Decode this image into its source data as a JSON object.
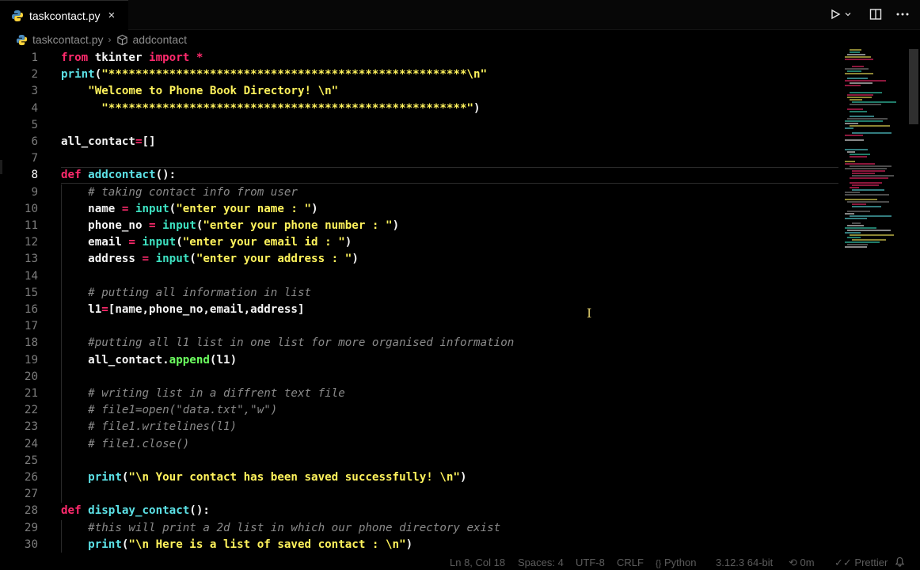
{
  "tab": {
    "filename": "taskcontact.py",
    "close_icon": "×"
  },
  "breadcrumb": {
    "file": "taskcontact.py",
    "symbol": "addcontact"
  },
  "toolbar": {
    "run_icon": "▷",
    "dropdown_icon": "⌄",
    "split_icon": "split-editor",
    "more_icon": "⋯"
  },
  "editor": {
    "current_line": 8,
    "lines": [
      {
        "n": "1",
        "tokens": [
          [
            "kw",
            "from"
          ],
          [
            "id",
            " tkinter "
          ],
          [
            "kw",
            "import"
          ],
          [
            "op",
            " *"
          ]
        ]
      },
      {
        "n": "2",
        "tokens": [
          [
            "fn",
            "print"
          ],
          [
            "pn",
            "("
          ],
          [
            "str",
            "\"*****************************************************\\n\""
          ]
        ]
      },
      {
        "n": "3",
        "tokens": [
          [
            "str",
            "    \"Welcome to Phone Book Directory! \\n\""
          ]
        ]
      },
      {
        "n": "4",
        "tokens": [
          [
            "str",
            "      \"*****************************************************\""
          ],
          [
            "pn",
            ")"
          ]
        ]
      },
      {
        "n": "5",
        "tokens": []
      },
      {
        "n": "6",
        "tokens": [
          [
            "id",
            "all_contact"
          ],
          [
            "op",
            "="
          ],
          [
            "pn",
            "[]"
          ]
        ]
      },
      {
        "n": "7",
        "tokens": []
      },
      {
        "n": "8",
        "tokens": [
          [
            "kw",
            "def"
          ],
          [
            "fn",
            " addcontact"
          ],
          [
            "pn",
            "():"
          ]
        ]
      },
      {
        "n": "9",
        "tokens": [
          [
            "cm",
            "    # taking contact info from user"
          ]
        ]
      },
      {
        "n": "10",
        "tokens": [
          [
            "id",
            "    name "
          ],
          [
            "op",
            "="
          ],
          [
            "bi",
            " input"
          ],
          [
            "pn",
            "("
          ],
          [
            "str",
            "\"enter your name : \""
          ],
          [
            "pn",
            ")"
          ]
        ]
      },
      {
        "n": "11",
        "tokens": [
          [
            "id",
            "    phone_no "
          ],
          [
            "op",
            "="
          ],
          [
            "bi",
            " input"
          ],
          [
            "pn",
            "("
          ],
          [
            "str",
            "\"enter your phone number : \""
          ],
          [
            "pn",
            ")"
          ]
        ]
      },
      {
        "n": "12",
        "tokens": [
          [
            "id",
            "    email "
          ],
          [
            "op",
            "="
          ],
          [
            "bi",
            " input"
          ],
          [
            "pn",
            "("
          ],
          [
            "str",
            "\"enter your email id : \""
          ],
          [
            "pn",
            ")"
          ]
        ]
      },
      {
        "n": "13",
        "tokens": [
          [
            "id",
            "    address "
          ],
          [
            "op",
            "="
          ],
          [
            "bi",
            " input"
          ],
          [
            "pn",
            "("
          ],
          [
            "str",
            "\"enter your address : \""
          ],
          [
            "pn",
            ")"
          ]
        ]
      },
      {
        "n": "14",
        "tokens": []
      },
      {
        "n": "15",
        "tokens": [
          [
            "cm",
            "    # putting all information in list"
          ]
        ]
      },
      {
        "n": "16",
        "tokens": [
          [
            "id",
            "    l1"
          ],
          [
            "op",
            "="
          ],
          [
            "pn",
            "["
          ],
          [
            "id",
            "name,phone_no,email,address"
          ],
          [
            "pn",
            "]"
          ]
        ]
      },
      {
        "n": "17",
        "tokens": []
      },
      {
        "n": "18",
        "tokens": [
          [
            "cm",
            "    #putting all l1 list in one list for more organised information"
          ]
        ]
      },
      {
        "n": "19",
        "tokens": [
          [
            "id",
            "    all_contact."
          ],
          [
            "meth",
            "append"
          ],
          [
            "pn",
            "("
          ],
          [
            "id",
            "l1"
          ],
          [
            "pn",
            ")"
          ]
        ]
      },
      {
        "n": "20",
        "tokens": []
      },
      {
        "n": "21",
        "tokens": [
          [
            "cm",
            "    # writing list in a diffrent text file"
          ]
        ]
      },
      {
        "n": "22",
        "tokens": [
          [
            "cm",
            "    # file1=open(\"data.txt\",\"w\")"
          ]
        ]
      },
      {
        "n": "23",
        "tokens": [
          [
            "cm",
            "    # file1.writelines(l1)"
          ]
        ]
      },
      {
        "n": "24",
        "tokens": [
          [
            "cm",
            "    # file1.close()"
          ]
        ]
      },
      {
        "n": "25",
        "tokens": []
      },
      {
        "n": "26",
        "tokens": [
          [
            "fn",
            "    print"
          ],
          [
            "pn",
            "("
          ],
          [
            "str",
            "\"\\n Your contact has been saved successfully! \\n\""
          ],
          [
            "pn",
            ")"
          ]
        ]
      },
      {
        "n": "27",
        "tokens": []
      },
      {
        "n": "28",
        "tokens": [
          [
            "kw",
            "def"
          ],
          [
            "fn",
            " display_contact"
          ],
          [
            "pn",
            "():"
          ]
        ]
      },
      {
        "n": "29",
        "tokens": [
          [
            "cm",
            "    #this will print a 2d list in which our phone directory exist"
          ]
        ]
      },
      {
        "n": "30",
        "tokens": [
          [
            "fn",
            "    print"
          ],
          [
            "pn",
            "("
          ],
          [
            "str",
            "\"\\n Here is a list of saved contact : \\n\""
          ],
          [
            "pn",
            ")"
          ]
        ]
      }
    ]
  },
  "statusbar": {
    "position": "Ln 8, Col 18",
    "spaces": "Spaces: 4",
    "encoding": "UTF-8",
    "eol": "CRLF",
    "language": "Python",
    "interpreter": "3.12.3 64-bit",
    "timer": "0m",
    "formatter": "Prettier"
  }
}
